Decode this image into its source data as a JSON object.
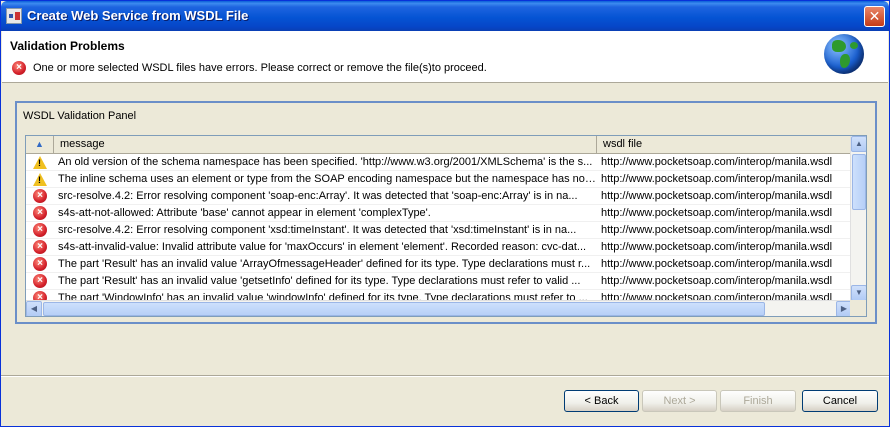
{
  "window": {
    "title": "Create Web Service from WSDL File",
    "close_glyph": "✕"
  },
  "header": {
    "title": "Validation Problems",
    "message": "One or more selected WSDL files have errors. Please correct or remove the file(s)to proceed."
  },
  "panel": {
    "label": "WSDL Validation Panel",
    "columns": {
      "sort": "▲",
      "message": "message",
      "wsdl": "wsdl file"
    },
    "rows": [
      {
        "severity": "warning",
        "message": "An old version of the schema namespace has been specified. 'http://www.w3.org/2001/XMLSchema' is the s...",
        "wsdl": "http://www.pocketsoap.com/interop/manila.wsdl"
      },
      {
        "severity": "warning",
        "message": "The inline schema uses an element or type from the SOAP encoding namespace but the namespace has not ...",
        "wsdl": "http://www.pocketsoap.com/interop/manila.wsdl"
      },
      {
        "severity": "error",
        "message": "src-resolve.4.2: Error resolving component 'soap-enc:Array'. It was detected that 'soap-enc:Array' is in na...",
        "wsdl": "http://www.pocketsoap.com/interop/manila.wsdl"
      },
      {
        "severity": "error",
        "message": "s4s-att-not-allowed: Attribute 'base' cannot appear in element 'complexType'.",
        "wsdl": "http://www.pocketsoap.com/interop/manila.wsdl"
      },
      {
        "severity": "error",
        "message": "src-resolve.4.2: Error resolving component 'xsd:timeInstant'. It was detected that 'xsd:timeInstant' is in na...",
        "wsdl": "http://www.pocketsoap.com/interop/manila.wsdl"
      },
      {
        "severity": "error",
        "message": "s4s-att-invalid-value: Invalid attribute value for 'maxOccurs' in element 'element'. Recorded reason: cvc-dat...",
        "wsdl": "http://www.pocketsoap.com/interop/manila.wsdl"
      },
      {
        "severity": "error",
        "message": "The part 'Result' has an invalid value 'ArrayOfmessageHeader' defined for its type. Type declarations must r...",
        "wsdl": "http://www.pocketsoap.com/interop/manila.wsdl"
      },
      {
        "severity": "error",
        "message": "The part 'Result' has an invalid value 'getsetInfo' defined for its type. Type declarations must refer to valid ...",
        "wsdl": "http://www.pocketsoap.com/interop/manila.wsdl"
      },
      {
        "severity": "error",
        "message": "The part 'WindowInfo' has an invalid value 'windowInfo' defined for its type. Type declarations must refer to ...",
        "wsdl": "http://www.pocketsoap.com/interop/manila.wsdl"
      }
    ]
  },
  "buttons": {
    "back": "< Back",
    "next": "Next >",
    "finish": "Finish",
    "cancel": "Cancel"
  },
  "icons": {
    "error": "error-icon",
    "warning": "warning-icon",
    "globe": "globe-icon"
  },
  "colors": {
    "titlebar": "#0554d4",
    "error": "#d3202a",
    "warning": "#f0c020",
    "panel_border": "#6b8fc8"
  }
}
